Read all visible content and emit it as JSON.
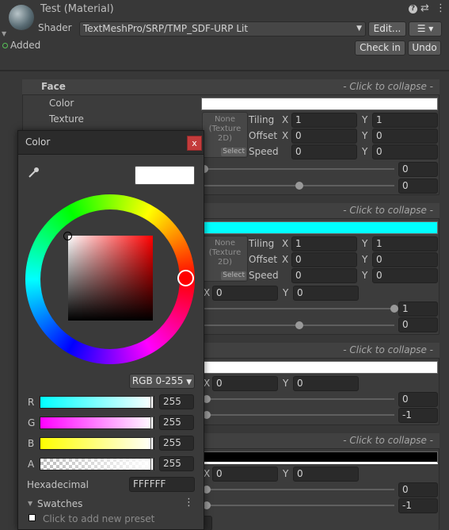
{
  "header": {
    "title": "Test (Material)",
    "shader_label": "Shader",
    "shader_value": "TextMeshPro/SRP/TMP_SDF-URP Lit",
    "edit_label": "Edit...",
    "added_label": "Added",
    "checkin_label": "Check in",
    "undo_label": "Undo",
    "help_icon": "question-icon",
    "settings_icon": "sliders-icon",
    "menu_icon": "kebab-icon",
    "shader_menu_icon": "list-icon"
  },
  "sections": {
    "face": {
      "title": "Face",
      "collapse": "- Click to collapse -",
      "color_label": "Color",
      "texture_label": "Texture",
      "color": "#ffffff",
      "tex_none": "None",
      "tex_type": "(Texture",
      "tex_type2": "2D)",
      "tex_select": "Select",
      "tiling_label": "Tiling",
      "offset_label": "Offset",
      "speed_label": "Speed",
      "x": "X",
      "y": "Y",
      "tiling_x": "1",
      "tiling_y": "1",
      "offset_x": "0",
      "offset_y": "0",
      "speed_x": "0",
      "speed_y": "0",
      "slider1_value": "0",
      "slider2_value": "0",
      "slider1": 0.0,
      "slider2": 0.5
    },
    "outline": {
      "collapse": "- Click to collapse -",
      "color": "#00ffff",
      "tex_none": "None",
      "tex_type": "(Texture",
      "tex_type2": "2D)",
      "tex_select": "Select",
      "tiling_label": "Tiling",
      "offset_label": "Offset",
      "speed_label": "Speed",
      "x": "X",
      "y": "Y",
      "tiling_x": "1",
      "tiling_y": "1",
      "offset_x": "0",
      "offset_y": "0",
      "speed_x": "0",
      "speed_y": "0",
      "pos_x": "0",
      "pos_y": "0",
      "slider1_value": "1",
      "slider2_value": "0",
      "slider1": 1.0,
      "slider2": 0.5
    },
    "underlay": {
      "collapse": "- Click to collapse -",
      "color": "#ffffff",
      "x": "X",
      "y": "Y",
      "pos_x": "0",
      "pos_y": "0",
      "slider1_value": "0",
      "slider2_value": "-1"
    },
    "lighting": {
      "collapse": "- Click to collapse -",
      "color": "#000000",
      "x": "X",
      "y": "Y",
      "pos_x": "0",
      "pos_y": "0",
      "slider1_value": "0",
      "slider2_value": "-1"
    }
  },
  "picker": {
    "title": "Color",
    "close": "x",
    "eyedropper_icon": "eyedropper-icon",
    "mode": "RGB 0-255",
    "r_label": "R",
    "g_label": "G",
    "b_label": "B",
    "a_label": "A",
    "r": "255",
    "g": "255",
    "b": "255",
    "a": "255",
    "hex_label": "Hexadecimal",
    "hex": "FFFFFF",
    "swatches_label": "Swatches",
    "swatches_menu_icon": "kebab-icon",
    "add_preset": "Click to add new preset",
    "swatch_color": "#ffffff",
    "current_color": "#ffffff"
  }
}
